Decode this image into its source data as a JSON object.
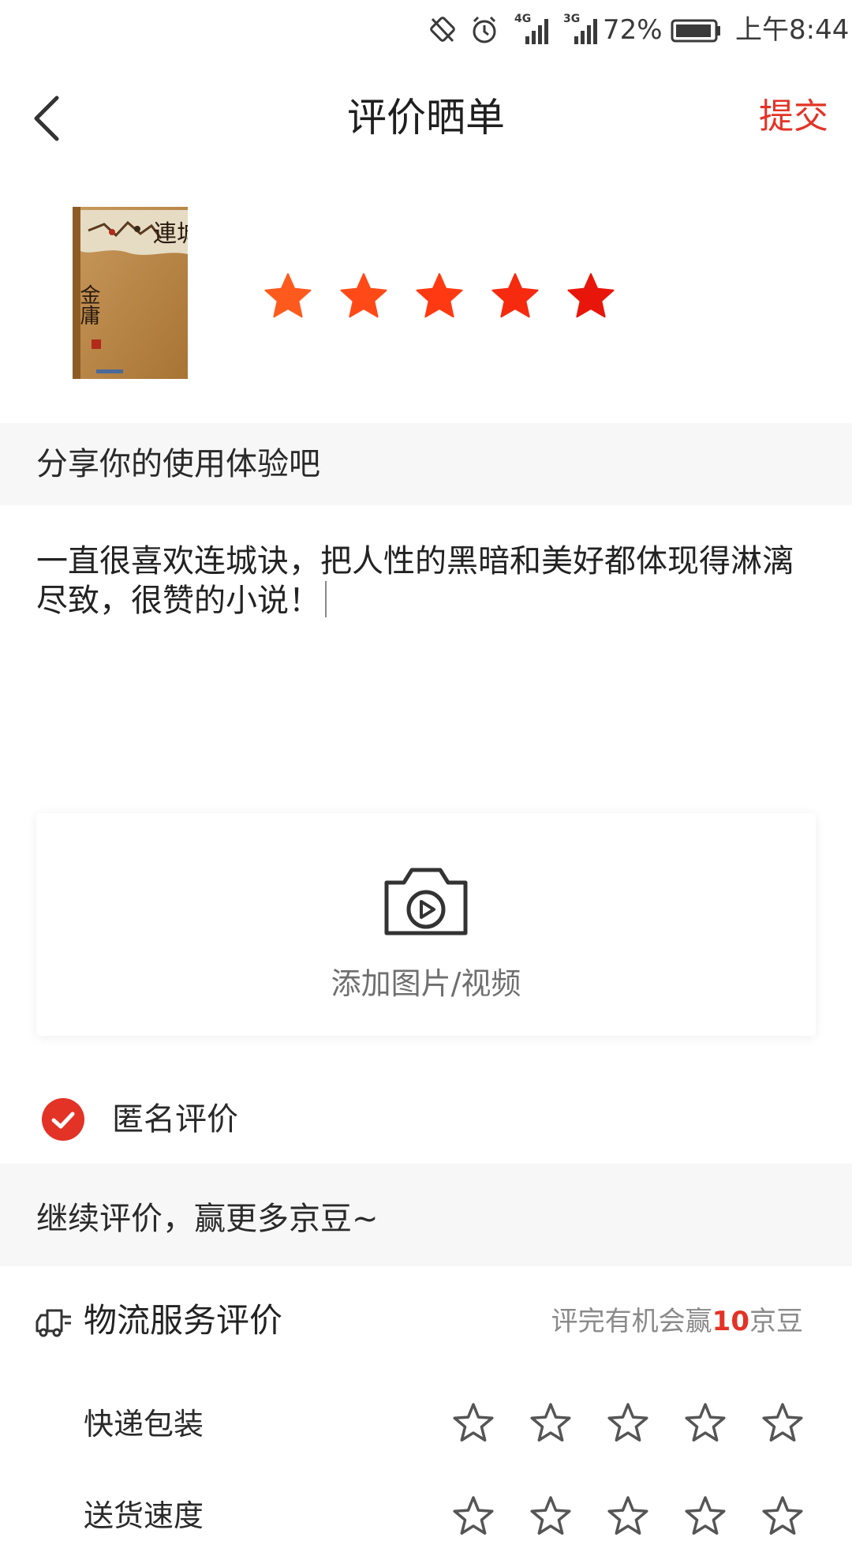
{
  "status_bar": {
    "signal_1": "4G",
    "signal_2": "3G",
    "battery": "72%",
    "time": "上午8:44"
  },
  "header": {
    "title": "评价晒单",
    "submit_label": "提交"
  },
  "product": {
    "cover_title": "連城訣",
    "cover_author": "金庸",
    "rating": 5,
    "star_colors": [
      "#ff5a1e",
      "#ff4a18",
      "#ff3a12",
      "#f62a0e",
      "#e8160a"
    ]
  },
  "review": {
    "section_title": "分享你的使用体验吧",
    "text": "一直很喜欢连城诀，把人性的黑暗和美好都体现得淋漓尽致，很赞的小说！"
  },
  "media": {
    "label": "添加图片/视频"
  },
  "anonymous": {
    "label": "匿名评价",
    "checked": true
  },
  "continue": {
    "title": "继续评价，赢更多京豆~"
  },
  "logistics": {
    "title": "物流服务评价",
    "tip_prefix": "评完有机会赢",
    "tip_number": "10",
    "tip_suffix": "京豆",
    "items": [
      {
        "label": "快递包装",
        "rating": 0
      },
      {
        "label": "送货速度",
        "rating": 0
      }
    ]
  },
  "colors": {
    "accent": "#e33326",
    "band": "#f7f7f7"
  }
}
